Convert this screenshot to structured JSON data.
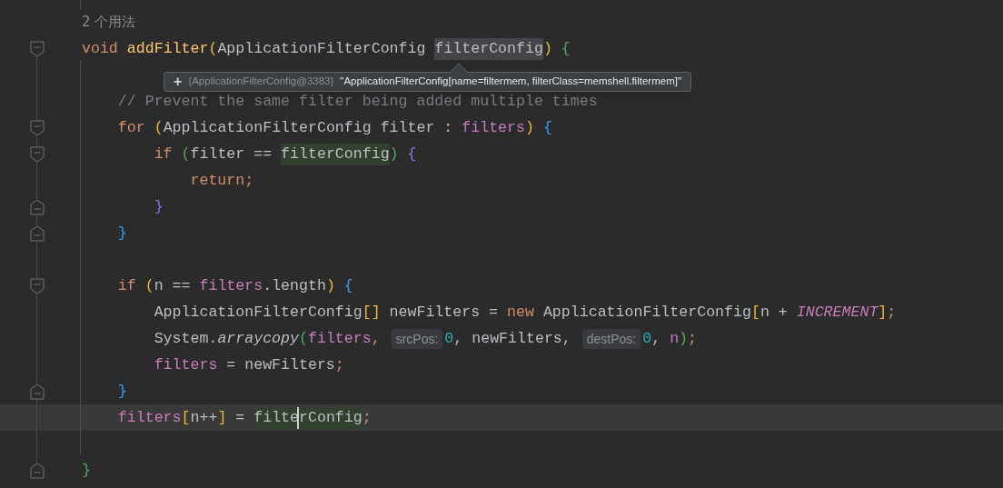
{
  "editor": {
    "lines": [
      {
        "kind": "usages",
        "text": "2 个用法",
        "current": false
      },
      {
        "kind": "code",
        "fold_marker": {
          "kind": "start"
        },
        "current": false,
        "tokens": [
          {
            "text": "void ",
            "kind": "kw"
          },
          {
            "text": "addFilter",
            "kind": "fn"
          },
          {
            "text": "(",
            "kind": "p1"
          },
          {
            "text": "ApplicationFilterConfig ",
            "kind": "plain"
          },
          {
            "text": "filterConfig",
            "kind": "hover"
          },
          {
            "text": ")",
            "kind": "p1"
          },
          {
            "text": " {",
            "kind": "p2"
          }
        ]
      },
      {
        "kind": "blank",
        "current": false
      },
      {
        "kind": "code",
        "current": false,
        "tokens": [
          {
            "text": "    // Prevent the same filter being added multiple times",
            "kind": "comment"
          }
        ]
      },
      {
        "kind": "code",
        "fold_marker": {
          "kind": "start"
        },
        "current": false,
        "tokens": [
          {
            "text": "    for ",
            "kind": "kw"
          },
          {
            "text": "(",
            "kind": "p1"
          },
          {
            "text": "ApplicationFilterConfig filter : ",
            "kind": "plain"
          },
          {
            "text": "filters",
            "kind": "field"
          },
          {
            "text": ")",
            "kind": "p1"
          },
          {
            "text": " {",
            "kind": "p3"
          }
        ]
      },
      {
        "kind": "code",
        "fold_marker": {
          "kind": "start"
        },
        "current": false,
        "tokens": [
          {
            "text": "        if ",
            "kind": "kw"
          },
          {
            "text": "(",
            "kind": "p2"
          },
          {
            "text": "filter == ",
            "kind": "plain"
          },
          {
            "text": "filterConfig",
            "kind": "ref"
          },
          {
            "text": ")",
            "kind": "p2"
          },
          {
            "text": " {",
            "kind": "p4"
          }
        ]
      },
      {
        "kind": "code",
        "current": false,
        "tokens": [
          {
            "text": "            return;",
            "kind": "kw"
          }
        ]
      },
      {
        "kind": "code",
        "fold_marker": {
          "kind": "end"
        },
        "current": false,
        "tokens": [
          {
            "text": "        }",
            "kind": "p4"
          }
        ]
      },
      {
        "kind": "code",
        "fold_marker": {
          "kind": "end"
        },
        "current": false,
        "tokens": [
          {
            "text": "    }",
            "kind": "p3"
          }
        ]
      },
      {
        "kind": "blank",
        "current": false
      },
      {
        "kind": "code",
        "fold_marker": {
          "kind": "start"
        },
        "current": false,
        "tokens": [
          {
            "text": "    if ",
            "kind": "kw"
          },
          {
            "text": "(",
            "kind": "p1"
          },
          {
            "text": "n == ",
            "kind": "plain"
          },
          {
            "text": "filters",
            "kind": "field"
          },
          {
            "text": ".length",
            "kind": "plain"
          },
          {
            "text": ")",
            "kind": "p1"
          },
          {
            "text": " {",
            "kind": "p3"
          }
        ]
      },
      {
        "kind": "code",
        "current": false,
        "tokens": [
          {
            "text": "        ApplicationFilterConfig",
            "kind": "plain"
          },
          {
            "text": "[]",
            "kind": "p1"
          },
          {
            "text": " newFilters = ",
            "kind": "plain"
          },
          {
            "text": "new ",
            "kind": "kw"
          },
          {
            "text": "ApplicationFilterConfig",
            "kind": "plain"
          },
          {
            "text": "[",
            "kind": "p1"
          },
          {
            "text": "n + ",
            "kind": "plain"
          },
          {
            "text": "INCREMENT",
            "kind": "const"
          },
          {
            "text": "]",
            "kind": "p1"
          },
          {
            "text": ";",
            "kind": "kw"
          }
        ]
      },
      {
        "kind": "code",
        "current": false,
        "tokens": [
          {
            "text": "        System.",
            "kind": "plain"
          },
          {
            "text": "arraycopy",
            "kind": "static"
          },
          {
            "text": "(",
            "kind": "p2"
          },
          {
            "text": "filters",
            "kind": "field"
          },
          {
            "text": ",",
            "kind": "kw"
          },
          {
            "text": "srcPos:",
            "kind": "hint"
          },
          {
            "text": "0",
            "kind": "num"
          },
          {
            "text": ", newFilters,",
            "kind": "plain"
          },
          {
            "text": "destPos:",
            "kind": "hint"
          },
          {
            "text": "0",
            "kind": "num"
          },
          {
            "text": ", ",
            "kind": "plain"
          },
          {
            "text": "n",
            "kind": "field"
          },
          {
            "text": ")",
            "kind": "p2"
          },
          {
            "text": ";",
            "kind": "kw"
          }
        ]
      },
      {
        "kind": "code",
        "current": false,
        "tokens": [
          {
            "text": "        filters",
            "kind": "field"
          },
          {
            "text": " = newFilters",
            "kind": "plain"
          },
          {
            "text": ";",
            "kind": "kw"
          }
        ]
      },
      {
        "kind": "code",
        "fold_marker": {
          "kind": "end"
        },
        "current": false,
        "tokens": [
          {
            "text": "    }",
            "kind": "p3"
          }
        ]
      },
      {
        "kind": "code",
        "current": true,
        "tokens": [
          {
            "text": "    filters",
            "kind": "field"
          },
          {
            "text": "[",
            "kind": "p1"
          },
          {
            "text": "n++",
            "kind": "plain"
          },
          {
            "text": "]",
            "kind": "p1"
          },
          {
            "text": " = ",
            "kind": "plain"
          },
          {
            "text": "filte",
            "kind": "ref",
            "caret": true
          },
          {
            "text": "rConfig",
            "kind": "ref"
          },
          {
            "text": ";",
            "kind": "kw"
          }
        ]
      },
      {
        "kind": "blank",
        "current": false
      },
      {
        "kind": "code",
        "fold_marker": {
          "kind": "end"
        },
        "current": false,
        "tokens": [
          {
            "text": "}",
            "kind": "p2"
          }
        ]
      }
    ]
  },
  "tooltip": {
    "expand": "+",
    "ref": "{ApplicationFilterConfig@3383}",
    "value": "\"ApplicationFilterConfig[name=filtermem, filterClass=memshell.filtermem]\""
  }
}
